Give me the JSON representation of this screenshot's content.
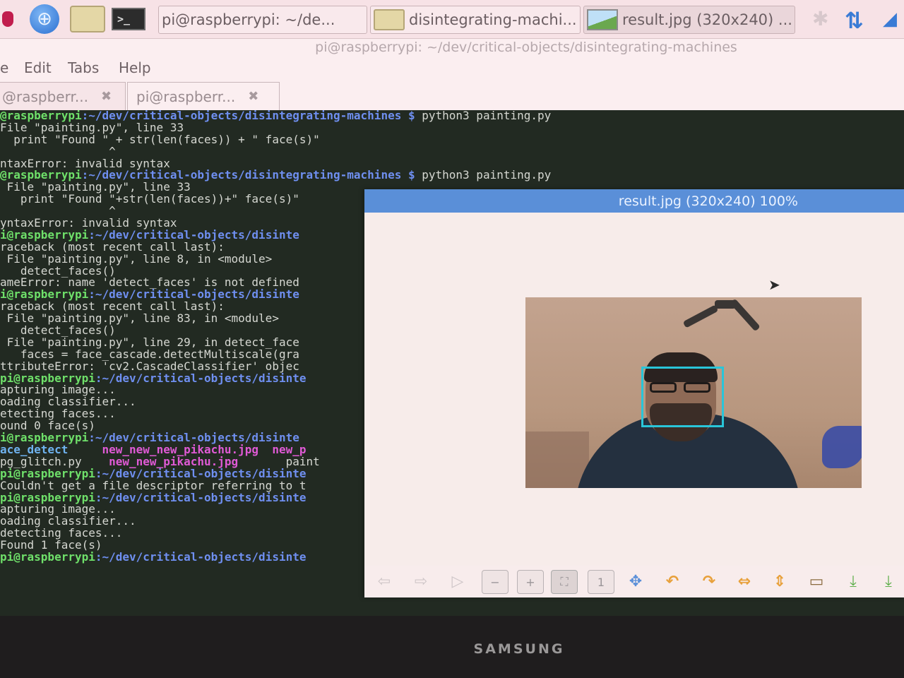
{
  "taskbar": {
    "tasks": [
      {
        "label": "pi@raspberrypi: ~/de...",
        "icon": "terminal-icon"
      },
      {
        "label": "disintegrating-machi...",
        "icon": "folder-icon"
      },
      {
        "label": "result.jpg (320x240) ...",
        "icon": "image-icon"
      }
    ]
  },
  "terminal": {
    "window_title": "pi@raspberrypi: ~/dev/critical-objects/disintegrating-machines",
    "menu": [
      "e",
      "Edit",
      "Tabs",
      "Help"
    ],
    "tabs": [
      {
        "label": "@raspberr...",
        "close": "✖"
      },
      {
        "label": "pi@raspberr...",
        "close": "✖"
      }
    ],
    "lines": [
      [
        {
          "t": "@raspberrypi",
          "c": "p"
        },
        {
          "t": ":~/dev/critical-objects/disintegrating-machines $",
          "c": "d"
        },
        {
          "t": " python3 painting.py",
          "c": ""
        }
      ],
      [
        {
          "t": "File \"painting.py\", line 33",
          "c": ""
        }
      ],
      [
        {
          "t": "  print \"Found \" + str(len(faces)) + \" face(s)\"",
          "c": ""
        }
      ],
      [
        {
          "t": "                ^",
          "c": ""
        }
      ],
      [
        {
          "t": "ntaxError: invalid syntax",
          "c": ""
        }
      ],
      [
        {
          "t": "@raspberrypi",
          "c": "p"
        },
        {
          "t": ":~/dev/critical-objects/disintegrating-machines $",
          "c": "d"
        },
        {
          "t": " python3 painting.py",
          "c": ""
        }
      ],
      [
        {
          "t": " File \"painting.py\", line 33",
          "c": ""
        }
      ],
      [
        {
          "t": "   print \"Found \"+str(len(faces))+\" face(s)\"",
          "c": ""
        }
      ],
      [
        {
          "t": "                ^",
          "c": ""
        }
      ],
      [
        {
          "t": "yntaxError: invalid syntax",
          "c": ""
        }
      ],
      [
        {
          "t": "i@raspberrypi",
          "c": "p"
        },
        {
          "t": ":~/dev/critical-objects/disinte",
          "c": "d"
        }
      ],
      [
        {
          "t": "raceback (most recent call last):",
          "c": ""
        }
      ],
      [
        {
          "t": " File \"painting.py\", line 8, in <module>",
          "c": ""
        }
      ],
      [
        {
          "t": "   detect_faces()",
          "c": ""
        }
      ],
      [
        {
          "t": "ameError: name 'detect_faces' is not defined",
          "c": ""
        }
      ],
      [
        {
          "t": "i@raspberrypi",
          "c": "p"
        },
        {
          "t": ":~/dev/critical-objects/disinte",
          "c": "d"
        }
      ],
      [
        {
          "t": "raceback (most recent call last):",
          "c": ""
        }
      ],
      [
        {
          "t": " File \"painting.py\", line 83, in <module>",
          "c": ""
        }
      ],
      [
        {
          "t": "   detect_faces()",
          "c": ""
        }
      ],
      [
        {
          "t": " File \"painting.py\", line 29, in detect_face",
          "c": ""
        }
      ],
      [
        {
          "t": "   faces = face_cascade.detectMultiscale(gra",
          "c": ""
        }
      ],
      [
        {
          "t": "ttributeError: 'cv2.CascadeClassifier' objec",
          "c": ""
        }
      ],
      [
        {
          "t": "pi@raspberrypi",
          "c": "p"
        },
        {
          "t": ":~/dev/critical-objects/disinte",
          "c": "d"
        }
      ],
      [
        {
          "t": "apturing image...",
          "c": ""
        }
      ],
      [
        {
          "t": "oading classifier...",
          "c": ""
        }
      ],
      [
        {
          "t": "etecting faces...",
          "c": ""
        }
      ],
      [
        {
          "t": "ound 0 face(s)",
          "c": ""
        }
      ],
      [
        {
          "t": "i@raspberrypi",
          "c": "p"
        },
        {
          "t": ":~/dev/critical-objects/disinte",
          "c": "d"
        }
      ],
      [
        {
          "t": "ace_detect",
          "c": "c"
        },
        {
          "t": "     ",
          "c": ""
        },
        {
          "t": "new_new_new_pikachu.jpg",
          "c": "m"
        },
        {
          "t": "  ",
          "c": ""
        },
        {
          "t": "new_p",
          "c": "m"
        }
      ],
      [
        {
          "t": "pg_glitch.py    ",
          "c": ""
        },
        {
          "t": "new_new_pikachu.jpg",
          "c": "m"
        },
        {
          "t": "       paint",
          "c": ""
        }
      ],
      [
        {
          "t": "pi@raspberrypi",
          "c": "p"
        },
        {
          "t": ":~/dev/critical-objects/disinte",
          "c": "d"
        }
      ],
      [
        {
          "t": "Couldn't get a file descriptor referring to t",
          "c": ""
        }
      ],
      [
        {
          "t": "pi@raspberrypi",
          "c": "p"
        },
        {
          "t": ":~/dev/critical-objects/disinte",
          "c": "d"
        }
      ],
      [
        {
          "t": "apturing image...",
          "c": ""
        }
      ],
      [
        {
          "t": "oading classifier...",
          "c": ""
        }
      ],
      [
        {
          "t": "detecting faces...",
          "c": ""
        }
      ],
      [
        {
          "t": "Found 1 face(s)",
          "c": ""
        }
      ],
      [
        {
          "t": "pi@raspberrypi",
          "c": "p"
        },
        {
          "t": ":~/dev/critical-objects/disinte",
          "c": "d"
        }
      ]
    ]
  },
  "viewer": {
    "title": "result.jpg (320x240) 100%",
    "toolbar": [
      {
        "name": "back-arrow-icon",
        "glyph": "⇦",
        "style": "dim"
      },
      {
        "name": "forward-arrow-icon",
        "glyph": "⇨",
        "style": "dim"
      },
      {
        "name": "play-icon",
        "glyph": "▷",
        "style": "dim"
      },
      {
        "name": "zoom-out-icon",
        "glyph": "−",
        "style": "box"
      },
      {
        "name": "zoom-in-icon",
        "glyph": "+",
        "style": "box"
      },
      {
        "name": "fit-window-icon",
        "glyph": "⛶",
        "style": "box sel"
      },
      {
        "name": "original-size-icon",
        "glyph": "1",
        "style": "box"
      },
      {
        "name": "fullscreen-icon",
        "glyph": "✥",
        "style": "blue"
      },
      {
        "name": "rotate-left-icon",
        "glyph": "↶",
        "style": "orange"
      },
      {
        "name": "rotate-right-icon",
        "glyph": "↷",
        "style": "orange"
      },
      {
        "name": "flip-horizontal-icon",
        "glyph": "⇔",
        "style": "orange"
      },
      {
        "name": "flip-vertical-icon",
        "glyph": "⇕",
        "style": "orange"
      },
      {
        "name": "open-file-icon",
        "glyph": "▭",
        "style": "brown"
      },
      {
        "name": "save-icon",
        "glyph": "⤓",
        "style": "green"
      },
      {
        "name": "save-as-icon",
        "glyph": "⤓",
        "style": "green"
      }
    ]
  },
  "monitor": {
    "brand": "SAMSUNG"
  }
}
